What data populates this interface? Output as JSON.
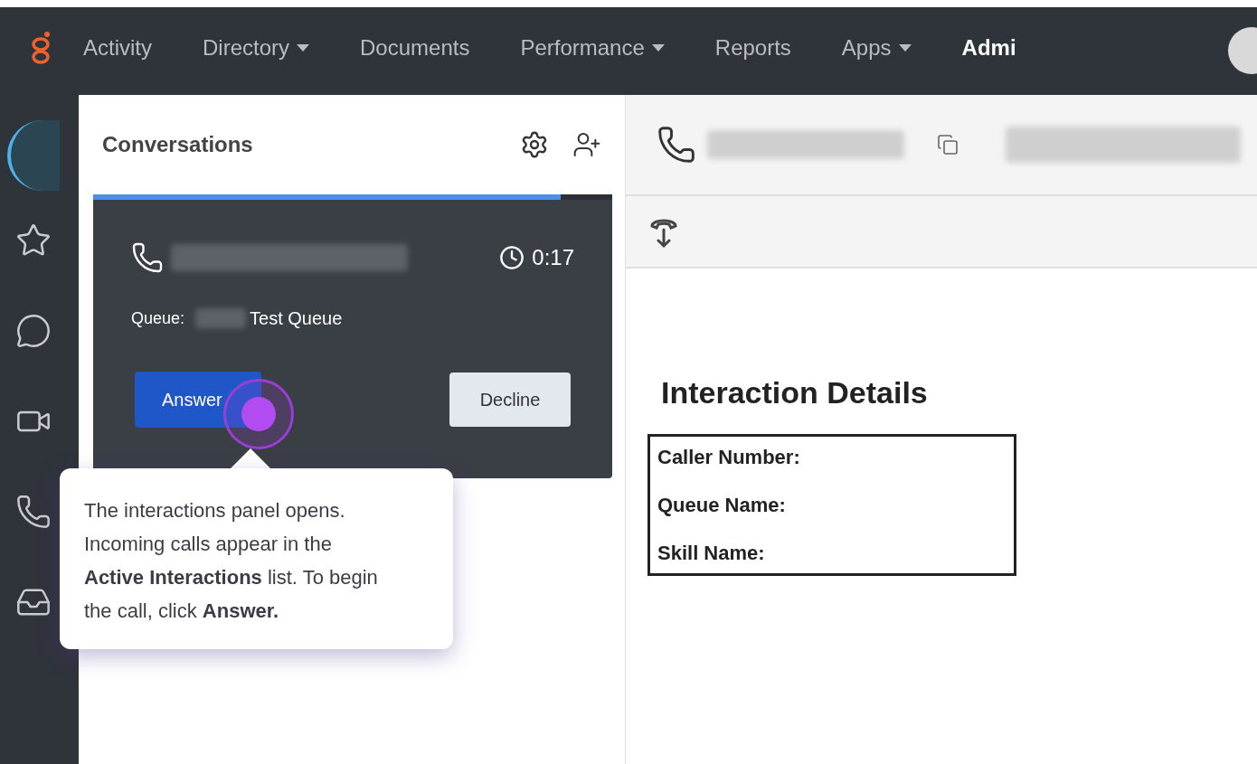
{
  "nav": {
    "items": [
      {
        "label": "Activity",
        "dropdown": false
      },
      {
        "label": "Directory",
        "dropdown": true
      },
      {
        "label": "Documents",
        "dropdown": false
      },
      {
        "label": "Performance",
        "dropdown": true
      },
      {
        "label": "Reports",
        "dropdown": false
      },
      {
        "label": "Apps",
        "dropdown": true
      },
      {
        "label": "Admi",
        "dropdown": false
      }
    ]
  },
  "conversations": {
    "title": "Conversations",
    "card": {
      "level": 0.9,
      "timer": "0:17",
      "queue_label": "Queue:",
      "queue_name": "Test Queue",
      "buttons": [
        {
          "label": "Answer",
          "kind": "primary"
        },
        {
          "label": "Decline",
          "kind": "secondary"
        }
      ]
    }
  },
  "tooltip": {
    "text": "The interactions panel opens. Incoming calls appear in the **Active Interactions** list. To begin the call, click **Answer.**"
  },
  "details": {
    "title": "Interaction Details",
    "fields": [
      "Caller Number:",
      "Queue Name:",
      "Skill Name:"
    ]
  }
}
